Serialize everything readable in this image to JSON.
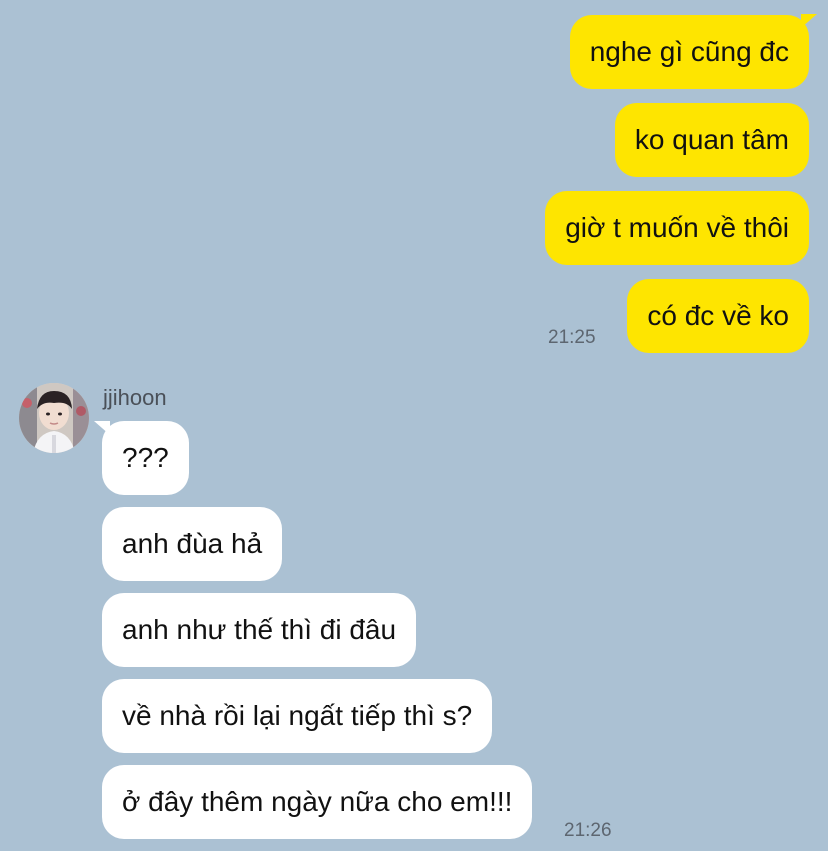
{
  "outgoing": [
    {
      "text": "nghe gì cũng đc"
    },
    {
      "text": "ko quan tâm"
    },
    {
      "text": "giờ t muốn về thôi"
    },
    {
      "text": "có đc về ko"
    }
  ],
  "outgoing_time": "21:25",
  "sender": {
    "name": "jjihoon",
    "avatar_icon": "profile-photo"
  },
  "incoming": [
    {
      "text": "???"
    },
    {
      "text": "anh đùa hả"
    },
    {
      "text": "anh như thế thì đi đâu"
    },
    {
      "text": "về nhà rồi lại ngất tiếp thì s?"
    },
    {
      "text": "ở đây thêm ngày nữa cho em!!!"
    }
  ],
  "incoming_time": "21:26",
  "colors": {
    "background": "#abc1d3",
    "outgoing_bubble": "#fee500",
    "incoming_bubble": "#ffffff"
  }
}
